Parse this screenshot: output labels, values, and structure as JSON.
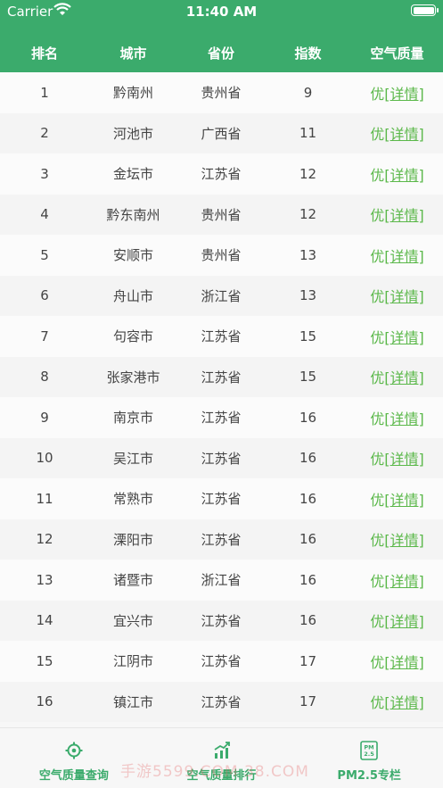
{
  "status": {
    "carrier": "Carrier",
    "time": "11:40 AM"
  },
  "columns": [
    "排名",
    "城市",
    "省份",
    "指数",
    "空气质量"
  ],
  "rows": [
    {
      "rank": "1",
      "city": "黔南州",
      "province": "贵州省",
      "index": "9",
      "quality": "优",
      "detail": "[详情]"
    },
    {
      "rank": "2",
      "city": "河池市",
      "province": "广西省",
      "index": "11",
      "quality": "优",
      "detail": "[详情]"
    },
    {
      "rank": "3",
      "city": "金坛市",
      "province": "江苏省",
      "index": "12",
      "quality": "优",
      "detail": "[详情]"
    },
    {
      "rank": "4",
      "city": "黔东南州",
      "province": "贵州省",
      "index": "12",
      "quality": "优",
      "detail": "[详情]"
    },
    {
      "rank": "5",
      "city": "安顺市",
      "province": "贵州省",
      "index": "13",
      "quality": "优",
      "detail": "[详情]"
    },
    {
      "rank": "6",
      "city": "舟山市",
      "province": "浙江省",
      "index": "13",
      "quality": "优",
      "detail": "[详情]"
    },
    {
      "rank": "7",
      "city": "句容市",
      "province": "江苏省",
      "index": "15",
      "quality": "优",
      "detail": "[详情]"
    },
    {
      "rank": "8",
      "city": "张家港市",
      "province": "江苏省",
      "index": "15",
      "quality": "优",
      "detail": "[详情]"
    },
    {
      "rank": "9",
      "city": "南京市",
      "province": "江苏省",
      "index": "16",
      "quality": "优",
      "detail": "[详情]"
    },
    {
      "rank": "10",
      "city": "吴江市",
      "province": "江苏省",
      "index": "16",
      "quality": "优",
      "detail": "[详情]"
    },
    {
      "rank": "11",
      "city": "常熟市",
      "province": "江苏省",
      "index": "16",
      "quality": "优",
      "detail": "[详情]"
    },
    {
      "rank": "12",
      "city": "溧阳市",
      "province": "江苏省",
      "index": "16",
      "quality": "优",
      "detail": "[详情]"
    },
    {
      "rank": "13",
      "city": "诸暨市",
      "province": "浙江省",
      "index": "16",
      "quality": "优",
      "detail": "[详情]"
    },
    {
      "rank": "14",
      "city": "宜兴市",
      "province": "江苏省",
      "index": "16",
      "quality": "优",
      "detail": "[详情]"
    },
    {
      "rank": "15",
      "city": "江阴市",
      "province": "江苏省",
      "index": "17",
      "quality": "优",
      "detail": "[详情]"
    },
    {
      "rank": "16",
      "city": "镇江市",
      "province": "江苏省",
      "index": "17",
      "quality": "优",
      "detail": "[详情]"
    }
  ],
  "tabbar": {
    "tab1": {
      "label": "空气质量查询",
      "icon": "location-target-icon"
    },
    "tab2": {
      "label": "空气质量排行",
      "icon": "ranking-chart-icon"
    },
    "tab3": {
      "label": "PM2.5专栏",
      "icon": "pm25-icon",
      "icon_text_top": "PM",
      "icon_text_bottom": "2.5"
    }
  },
  "watermark": "手游5599.COM 38.COM",
  "colors": {
    "accent": "#3bab6c",
    "quality_good": "#5bb84a"
  }
}
